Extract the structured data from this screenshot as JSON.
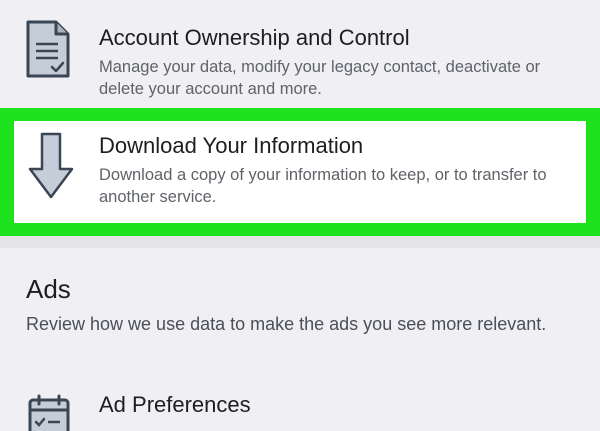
{
  "settings": {
    "account_ownership": {
      "title": "Account Ownership and Control",
      "description": "Manage your data, modify your legacy contact, deactivate or delete your account and more.",
      "icon": "document-icon"
    },
    "download_info": {
      "title": "Download Your Information",
      "description": "Download a copy of your information to keep, or to transfer to another service.",
      "icon": "download-arrow-icon",
      "highlight_color": "#1ee21e"
    },
    "ads": {
      "section_title": "Ads",
      "section_description": "Review how we use data to make the ads you see more relevant.",
      "preferences": {
        "title": "Ad Preferences",
        "icon": "calendar-checklist-icon"
      }
    }
  }
}
